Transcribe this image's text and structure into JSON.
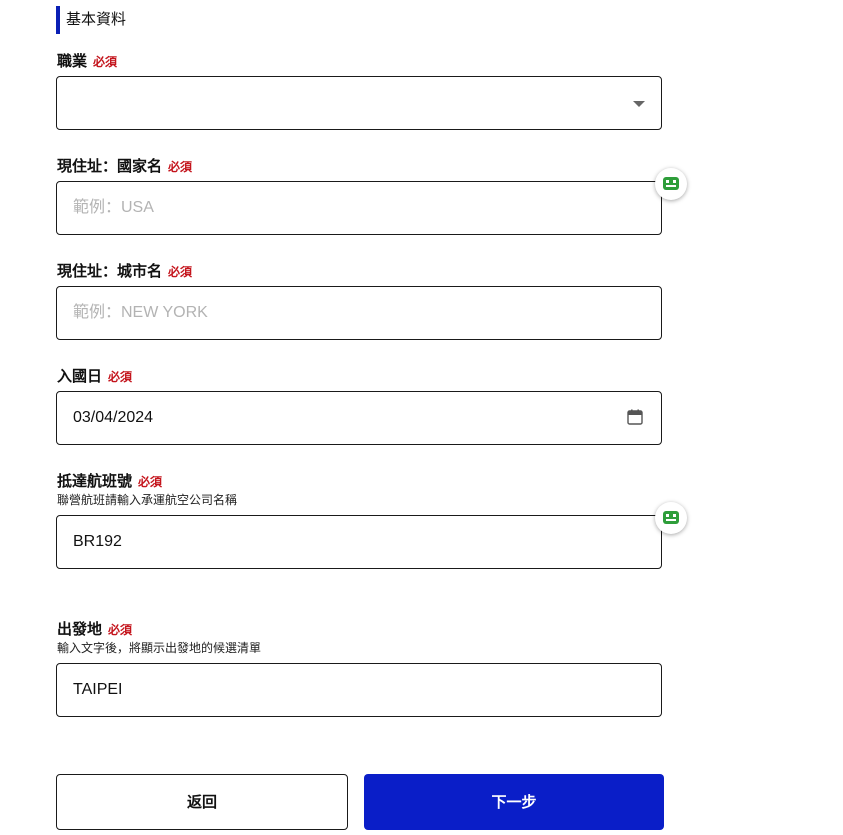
{
  "section": {
    "title": "基本資料"
  },
  "required_label": "必須",
  "fields": {
    "occupation": {
      "label": "職業",
      "value": ""
    },
    "country": {
      "label": "現住址：國家名",
      "placeholder": "範例：USA",
      "value": ""
    },
    "city": {
      "label": "現住址：城市名",
      "placeholder": "範例：NEW YORK",
      "value": ""
    },
    "entry_date": {
      "label": "入國日",
      "value": "03/04/2024"
    },
    "flight": {
      "label": "抵達航班號",
      "hint": "聯營航班請輸入承運航空公司名稱",
      "value": "BR192"
    },
    "departure": {
      "label": "出發地",
      "hint": "輸入文字後，將顯示出發地的候選清單",
      "value": "TAIPEI"
    }
  },
  "buttons": {
    "back": "返回",
    "next": "下一步"
  },
  "icons": {
    "select_caret": "chevron-down-icon",
    "calendar": "calendar-icon",
    "autofill_badge": "password-manager-icon"
  },
  "colors": {
    "accent": "#0a1ec8",
    "required": "#c4141c",
    "placeholder": "#b3b3b3",
    "badge_green": "#2e9e3a"
  }
}
